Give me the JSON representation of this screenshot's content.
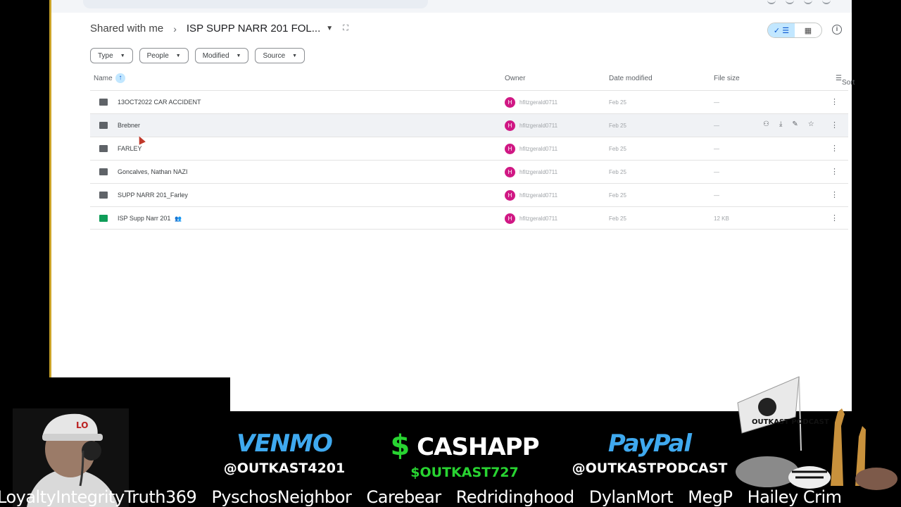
{
  "breadcrumb": {
    "root": "Shared with me",
    "current": "ISP SUPP NARR 201 FOL..."
  },
  "filters": [
    "Type",
    "People",
    "Modified",
    "Source"
  ],
  "columns": {
    "name": "Name",
    "owner": "Owner",
    "date": "Date modified",
    "size": "File size",
    "sort": "Sort"
  },
  "files": [
    {
      "name": "13OCT2022 CAR ACCIDENT",
      "type": "folder",
      "owner": "hfitzgerald0711",
      "owner_initial": "H",
      "date": "Feb 25",
      "size": "—"
    },
    {
      "name": "Brebner",
      "type": "folder",
      "owner": "hfitzgerald0711",
      "owner_initial": "H",
      "date": "Feb 25",
      "size": "—"
    },
    {
      "name": "FARLEY",
      "type": "folder",
      "owner": "hfitzgerald0711",
      "owner_initial": "H",
      "date": "Feb 25",
      "size": "—"
    },
    {
      "name": "Goncalves, Nathan NAZI",
      "type": "folder",
      "owner": "hfitzgerald0711",
      "owner_initial": "H",
      "date": "Feb 25",
      "size": "—"
    },
    {
      "name": "SUPP NARR 201_Farley",
      "type": "folder",
      "owner": "hfitzgerald0711",
      "owner_initial": "H",
      "date": "Feb 25",
      "size": "—"
    },
    {
      "name": "ISP Supp Narr 201",
      "type": "sheet",
      "owner": "hfitzgerald0711",
      "owner_initial": "H",
      "date": "Feb 25",
      "size": "12 KB"
    }
  ],
  "promo": {
    "venmo_label": "VENMO",
    "venmo_handle": "@OUTKAST4201",
    "cash_dollar": "$",
    "cash_label": "CASHAPP",
    "cash_handle": "$OUTKAST727",
    "paypal_label": "PayPal",
    "paypal_handle": "@OUTKASTPODCAST"
  },
  "logo_text": "OUTKAST PODCAST",
  "ticker": [
    "LoyaltyIntegrityTruth369",
    "PyschosNeighbor",
    "Carebear",
    "Redridinghood",
    "DylanMort",
    "MegP",
    "Hailey Crim"
  ],
  "colors": {
    "accent": "#0b57d0",
    "owner_avatar": "#d01884",
    "venmo": "#3fa9ef",
    "cash": "#28d431"
  }
}
